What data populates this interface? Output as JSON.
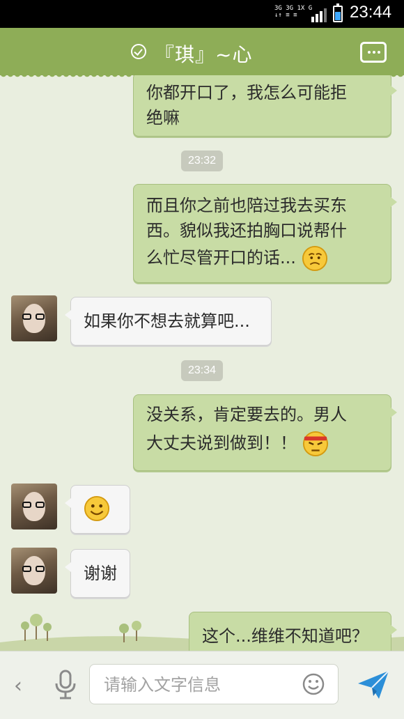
{
  "status_bar": {
    "network_line1": "3G 3G 1X G",
    "network_line2": "↓↑ ≡ ≡",
    "time": "23:44",
    "battery_level": 0.6
  },
  "header": {
    "title": "『琪』~心",
    "check_icon": "check-circle-icon",
    "menu_icon": "more-dots-icon"
  },
  "messages": [
    {
      "side": "right",
      "lines": [
        "你都开口了，我怎么可能拒",
        "绝嘛"
      ]
    },
    {
      "type": "time",
      "text": "23:32"
    },
    {
      "side": "right",
      "lines": [
        "而且你之前也陪过我去买东",
        "西。貌似我还拍胸口说帮什",
        "么忙尽管开口的话..."
      ],
      "emoji": "worried-face"
    },
    {
      "side": "left",
      "text": "如果你不想去就算吧..."
    },
    {
      "type": "time",
      "text": "23:34"
    },
    {
      "side": "right",
      "lines": [
        "没关系，肯定要去的。男人",
        "大丈夫说到做到！！"
      ],
      "emoji": "determined-face"
    },
    {
      "side": "left",
      "emoji": "smile-face"
    },
    {
      "side": "left",
      "text": "谢谢"
    },
    {
      "side": "right",
      "text": "这个...维维不知道吧？"
    }
  ],
  "input_bar": {
    "placeholder": "请输入文字信息",
    "back_icon": "chevron-left-icon",
    "mic_icon": "microphone-icon",
    "emoji_icon": "smiley-icon",
    "send_icon": "send-paper-plane-icon"
  },
  "colors": {
    "header": "#8ead57",
    "chat_bg": "#e9eedf",
    "sent_bubble": "#c8dca5",
    "received_bubble": "#f6f6f6",
    "send_icon": "#2c8fd8"
  }
}
